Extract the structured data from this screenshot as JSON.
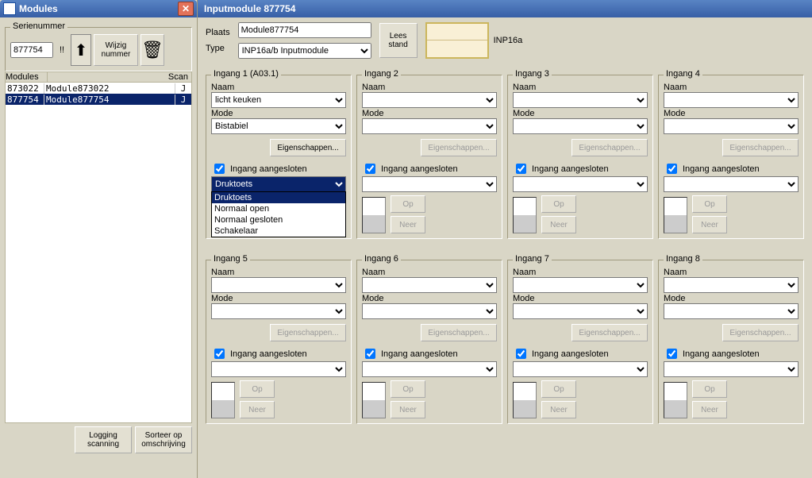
{
  "left": {
    "title": "Modules",
    "serienummer_legend": "Serienummer",
    "serienummer_value": "877754",
    "wijzig_btn": "Wijzig nummer",
    "cols": {
      "modules": "Modules",
      "scan": "Scan"
    },
    "rows": [
      {
        "id": "873022",
        "name": "Module873022",
        "scan": "J",
        "selected": false
      },
      {
        "id": "877754",
        "name": "Module877754",
        "scan": "J",
        "selected": true
      }
    ],
    "logging_btn": "Logging scanning",
    "sort_btn": "Sorteer op omschrijving"
  },
  "right": {
    "title": "Inputmodule 877754",
    "plaats_label": "Plaats",
    "plaats_value": "Module877754",
    "type_label": "Type",
    "type_value": "INP16a/b Inputmodule",
    "lees_btn": "Lees stand",
    "thumb_label": "INP16a",
    "ingang_generic": {
      "naam_label": "Naam",
      "mode_label": "Mode",
      "props_btn": "Eigenschappen...",
      "chk_label": "Ingang aangesloten",
      "op_btn": "Op",
      "neer_btn": "Neer"
    },
    "ingangen_top": [
      {
        "legend": "Ingang 1 (A03.1)",
        "naam": "licht keuken",
        "mode": "Bistabiel",
        "props_enabled": true,
        "dropdown_sel": "Druktoets",
        "popup": [
          "Druktoets",
          "Normaal open",
          "Normaal gesloten",
          "Schakelaar"
        ]
      },
      {
        "legend": "Ingang 2"
      },
      {
        "legend": "Ingang 3"
      },
      {
        "legend": "Ingang 4"
      }
    ],
    "ingangen_bottom": [
      {
        "legend": "Ingang 5"
      },
      {
        "legend": "Ingang 6"
      },
      {
        "legend": "Ingang 7"
      },
      {
        "legend": "Ingang 8"
      }
    ]
  }
}
